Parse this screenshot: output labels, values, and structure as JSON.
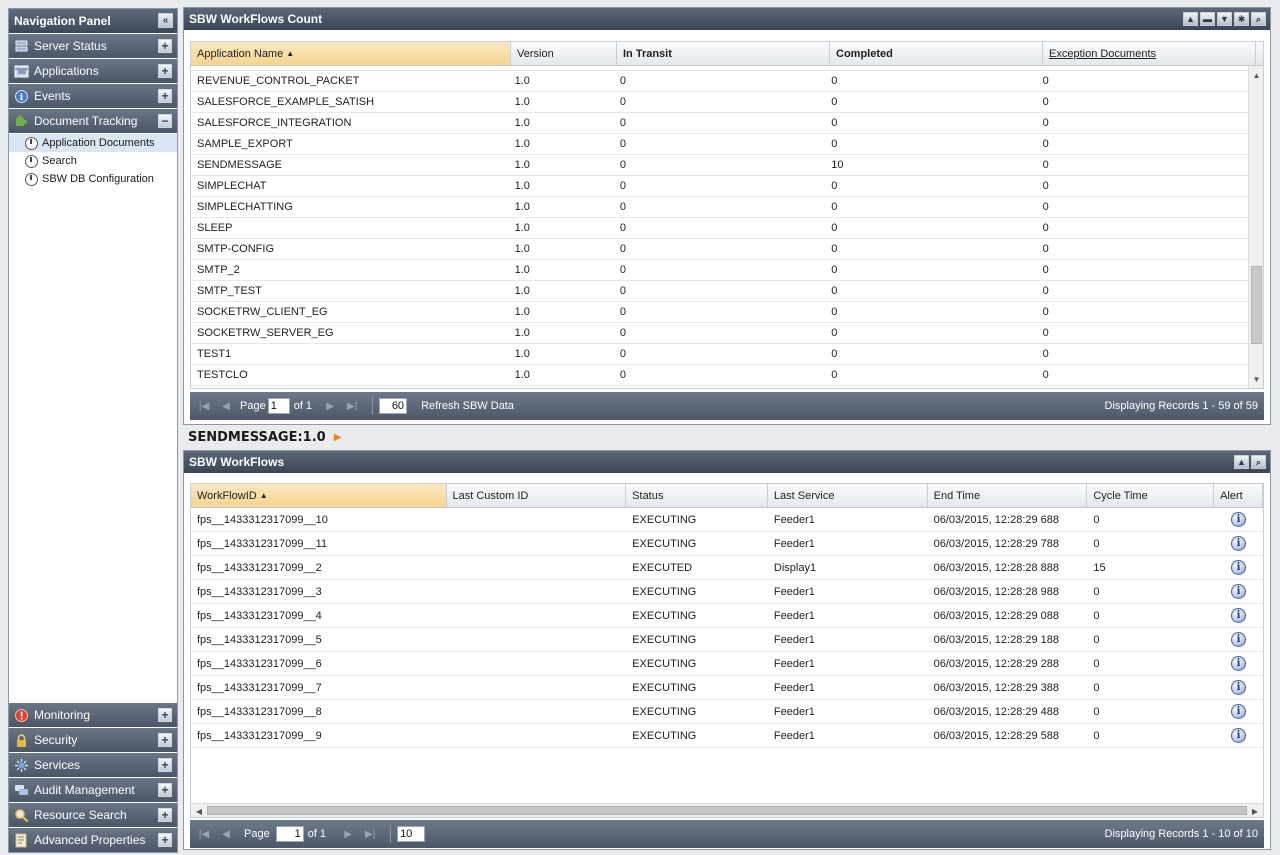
{
  "nav": {
    "title": "Navigation Panel",
    "top_items": [
      {
        "label": "Server Status",
        "icon": "server-icon",
        "expanded": false
      },
      {
        "label": "Applications",
        "icon": "applications-icon",
        "expanded": false
      },
      {
        "label": "Events",
        "icon": "info-icon",
        "expanded": false
      },
      {
        "label": "Document Tracking",
        "icon": "puzzle-icon",
        "expanded": true
      }
    ],
    "sub_items": [
      {
        "label": "Application Documents",
        "active": true
      },
      {
        "label": "Search",
        "active": false
      },
      {
        "label": "SBW DB Configuration",
        "active": false
      }
    ],
    "bottom_items": [
      {
        "label": "Monitoring",
        "icon": "alert-icon"
      },
      {
        "label": "Security",
        "icon": "lock-icon"
      },
      {
        "label": "Services",
        "icon": "services-icon"
      },
      {
        "label": "Audit Management",
        "icon": "chat-icon"
      },
      {
        "label": "Resource Search",
        "icon": "magnifier-icon"
      },
      {
        "label": "Advanced Properties",
        "icon": "properties-icon"
      }
    ]
  },
  "count_panel": {
    "title": "SBW WorkFlows Count",
    "columns": [
      "Application Name",
      "Version",
      "In Transit",
      "Completed",
      "Exception Documents"
    ],
    "rows": [
      [
        "REVENUE_CONTROL_PACKET",
        "1.0",
        "0",
        "0",
        "0"
      ],
      [
        "SALESFORCE_EXAMPLE_SATISH",
        "1.0",
        "0",
        "0",
        "0"
      ],
      [
        "SALESFORCE_INTEGRATION",
        "1.0",
        "0",
        "0",
        "0"
      ],
      [
        "SAMPLE_EXPORT",
        "1.0",
        "0",
        "0",
        "0"
      ],
      [
        "SENDMESSAGE",
        "1.0",
        "0",
        "10",
        "0"
      ],
      [
        "SIMPLECHAT",
        "1.0",
        "0",
        "0",
        "0"
      ],
      [
        "SIMPLECHATTING",
        "1.0",
        "0",
        "0",
        "0"
      ],
      [
        "SLEEP",
        "1.0",
        "0",
        "0",
        "0"
      ],
      [
        "SMTP-CONFIG",
        "1.0",
        "0",
        "0",
        "0"
      ],
      [
        "SMTP_2",
        "1.0",
        "0",
        "0",
        "0"
      ],
      [
        "SMTP_TEST",
        "1.0",
        "0",
        "0",
        "0"
      ],
      [
        "SOCKETRW_CLIENT_EG",
        "1.0",
        "0",
        "0",
        "0"
      ],
      [
        "SOCKETRW_SERVER_EG",
        "1.0",
        "0",
        "0",
        "0"
      ],
      [
        "TEST1",
        "1.0",
        "0",
        "0",
        "0"
      ],
      [
        "TESTCLO",
        "1.0",
        "0",
        "0",
        "0"
      ]
    ],
    "pager": {
      "page_label": "Page",
      "page": "1",
      "of_label": "of 1",
      "page_size": "60",
      "refresh_label": "Refresh SBW Data",
      "display_text": "Displaying Records 1 - 59 of 59"
    }
  },
  "detail_label": "SENDMESSAGE:1.0",
  "workflows_panel": {
    "title": "SBW WorkFlows",
    "columns": [
      "WorkFlowID",
      "Last Custom ID",
      "Status",
      "Last Service",
      "End Time",
      "Cycle Time",
      "Alert"
    ],
    "rows": [
      [
        "fps__1433312317099__10",
        "",
        "EXECUTING",
        "Feeder1",
        "06/03/2015, 12:28:29 688",
        "0"
      ],
      [
        "fps__1433312317099__11",
        "",
        "EXECUTING",
        "Feeder1",
        "06/03/2015, 12:28:29 788",
        "0"
      ],
      [
        "fps__1433312317099__2",
        "",
        "EXECUTED",
        "Display1",
        "06/03/2015, 12:28:28 888",
        "15"
      ],
      [
        "fps__1433312317099__3",
        "",
        "EXECUTING",
        "Feeder1",
        "06/03/2015, 12:28:28 988",
        "0"
      ],
      [
        "fps__1433312317099__4",
        "",
        "EXECUTING",
        "Feeder1",
        "06/03/2015, 12:28:29 088",
        "0"
      ],
      [
        "fps__1433312317099__5",
        "",
        "EXECUTING",
        "Feeder1",
        "06/03/2015, 12:28:29 188",
        "0"
      ],
      [
        "fps__1433312317099__6",
        "",
        "EXECUTING",
        "Feeder1",
        "06/03/2015, 12:28:29 288",
        "0"
      ],
      [
        "fps__1433312317099__7",
        "",
        "EXECUTING",
        "Feeder1",
        "06/03/2015, 12:28:29 388",
        "0"
      ],
      [
        "fps__1433312317099__8",
        "",
        "EXECUTING",
        "Feeder1",
        "06/03/2015, 12:28:29 488",
        "0"
      ],
      [
        "fps__1433312317099__9",
        "",
        "EXECUTING",
        "Feeder1",
        "06/03/2015, 12:28:29 588",
        "0"
      ]
    ],
    "pager": {
      "page_label": "Page",
      "page": "1",
      "of_label": "of 1",
      "page_size": "10",
      "display_text": "Displaying Records 1 - 10 of 10"
    }
  }
}
